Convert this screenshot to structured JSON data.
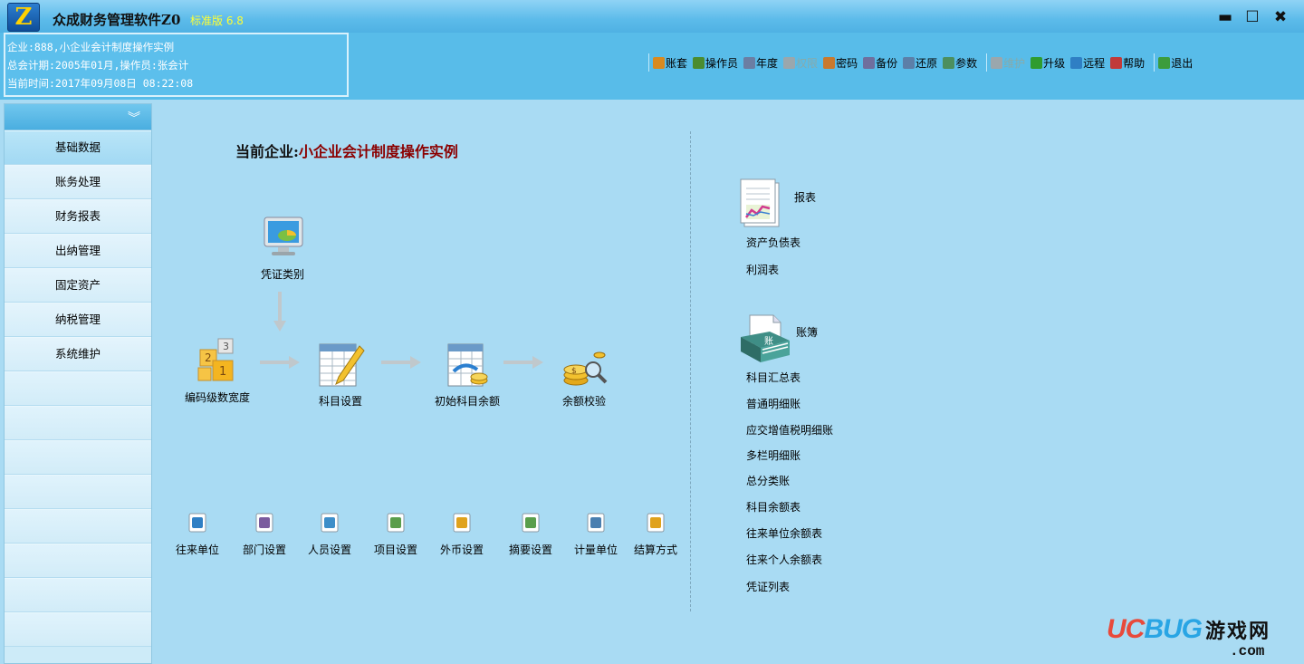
{
  "window": {
    "title": "众成财务管理软件Z0",
    "edition": "标准版 6.8",
    "minimize": "▬",
    "maximize": "☐",
    "close": "✖"
  },
  "info": {
    "company": "企业:888,小企业会计制度操作实例",
    "period": "总会计期:2005年01月,操作员:张会计",
    "time": "当前时间:2017年09月08日  08:22:08"
  },
  "toolbar": [
    {
      "label": "账套",
      "icon": "ledger-icon",
      "color": "#d98a1f"
    },
    {
      "label": "操作员",
      "icon": "users-icon",
      "color": "#4b8c2f"
    },
    {
      "label": "年度",
      "icon": "calendar-icon",
      "color": "#6b7ea3"
    },
    {
      "label": "权限",
      "icon": "permission-icon",
      "color": "#9aa7ad",
      "disabled": true
    },
    {
      "label": "密码",
      "icon": "key-icon",
      "color": "#c9792e"
    },
    {
      "label": "备份",
      "icon": "backup-icon",
      "color": "#6f6f9e"
    },
    {
      "label": "还原",
      "icon": "restore-icon",
      "color": "#5c7fa8"
    },
    {
      "label": "参数",
      "icon": "settings-icon",
      "color": "#4c8f5e"
    },
    {
      "label": "维护",
      "icon": "maintenance-icon",
      "color": "#9aa7ad",
      "disabled": true
    },
    {
      "label": "升级",
      "icon": "check-icon",
      "color": "#2f9c2f"
    },
    {
      "label": "远程",
      "icon": "globe-icon",
      "color": "#2f7fc4"
    },
    {
      "label": "帮助",
      "icon": "help-book-icon",
      "color": "#c13a3a"
    },
    {
      "label": "退出",
      "icon": "exit-icon",
      "color": "#3c9c3c"
    }
  ],
  "nav": {
    "collapse": "︾",
    "items": [
      "基础数据",
      "账务处理",
      "财务报表",
      "出纳管理",
      "固定资产",
      "纳税管理",
      "系统维护"
    ]
  },
  "main": {
    "company_label": "当前企业:",
    "company_name": "小企业会计制度操作实例",
    "flow": {
      "voucher_type": "凭证类别",
      "code_levels": "编码级数宽度",
      "account_setup": "科目设置",
      "initial_balance": "初始科目余额",
      "balance_check": "余额校验"
    },
    "shortcuts": [
      "往来单位",
      "部门设置",
      "人员设置",
      "项目设置",
      "外币设置",
      "摘要设置",
      "计量单位",
      "结算方式"
    ],
    "reports": {
      "heading": "报表",
      "items": [
        "资产负债表",
        "利润表"
      ]
    },
    "ledgers": {
      "heading": "账簿",
      "items": [
        "科目汇总表",
        "普通明细账",
        "应交增值税明细账",
        "多栏明细账",
        "总分类账",
        "科目余额表",
        "往来单位余额表",
        "往来个人余额表",
        "凭证列表"
      ]
    }
  },
  "watermark": {
    "brand_u": "UC",
    "brand_b": "BUG",
    "cn": "游戏网",
    "com": ".com"
  }
}
